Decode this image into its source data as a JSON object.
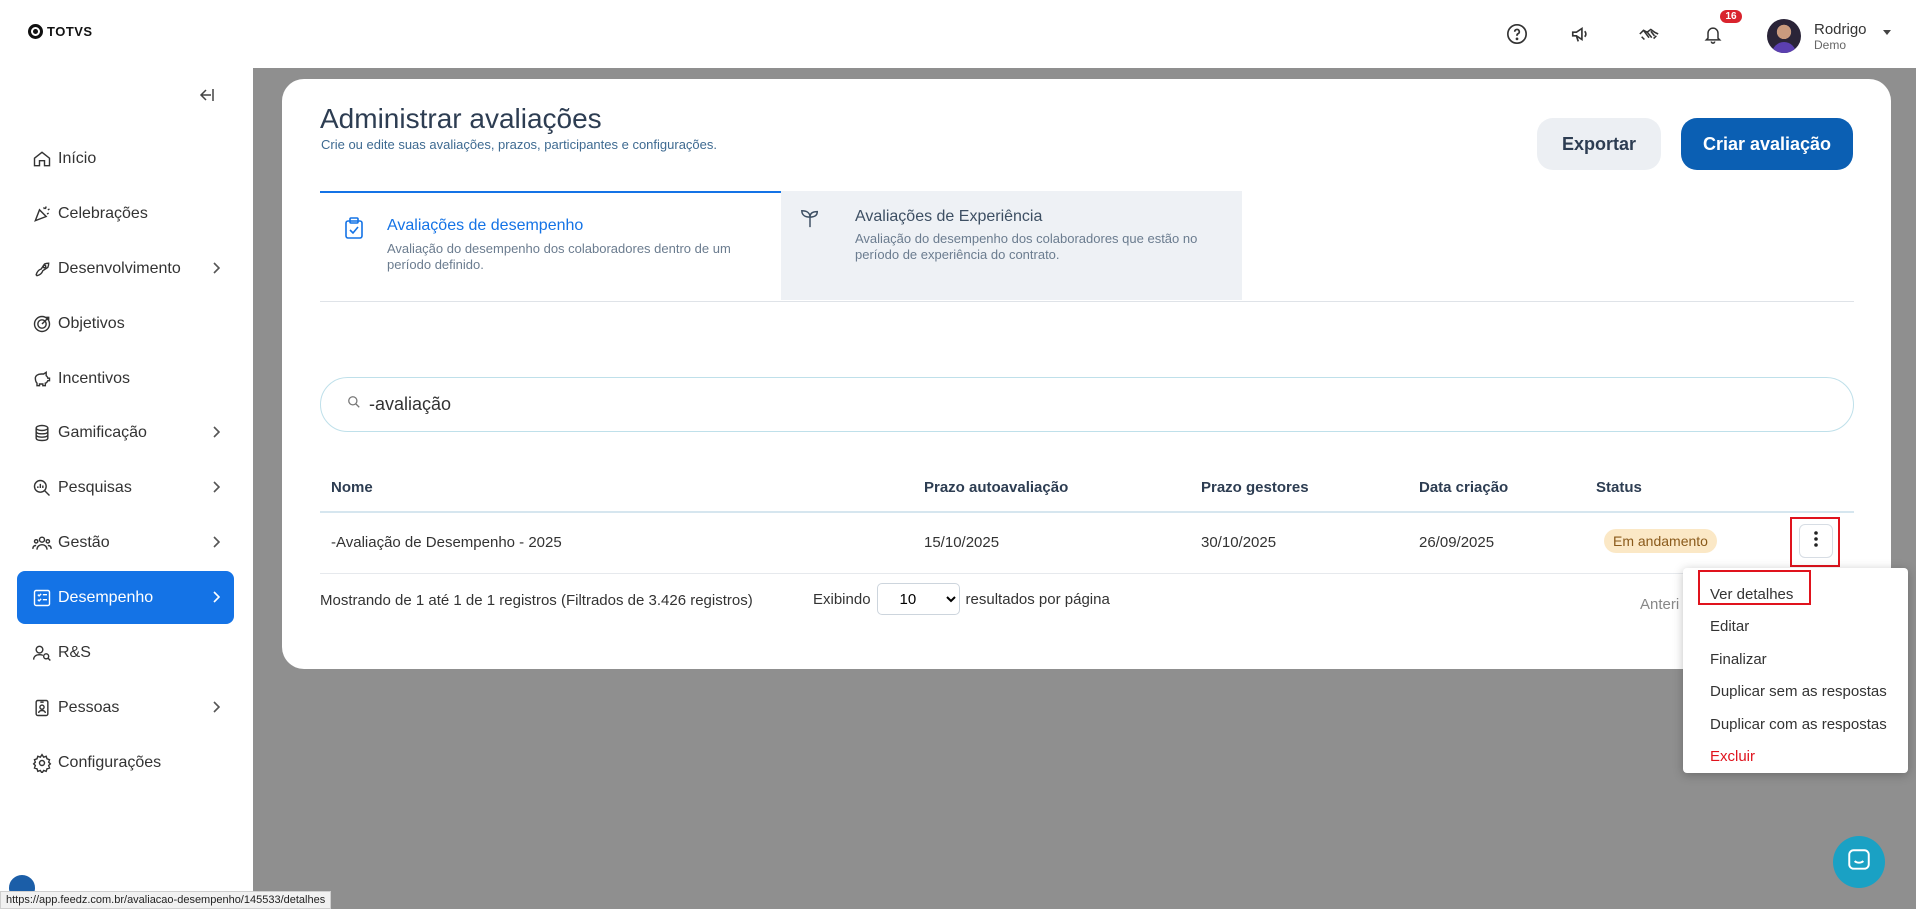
{
  "header": {
    "logo_text": "TOTVS",
    "notification_count": "16",
    "user_name": "Rodrigo",
    "user_subtitle": "Demo",
    "icons": [
      "help-icon",
      "megaphone-icon",
      "handshake-icon",
      "bell-icon"
    ]
  },
  "sidebar": {
    "collapse_icon": "collapse-left-icon",
    "items": [
      {
        "label": "Início",
        "icon": "home-icon",
        "chevron": false
      },
      {
        "label": "Celebrações",
        "icon": "party-icon",
        "chevron": false
      },
      {
        "label": "Desenvolvimento",
        "icon": "rocket-icon",
        "chevron": true
      },
      {
        "label": "Objetivos",
        "icon": "target-icon",
        "chevron": false
      },
      {
        "label": "Incentivos",
        "icon": "piggy-bank-icon",
        "chevron": false
      },
      {
        "label": "Gamificação",
        "icon": "coins-icon",
        "chevron": true
      },
      {
        "label": "Pesquisas",
        "icon": "chart-search-icon",
        "chevron": true
      },
      {
        "label": "Gestão",
        "icon": "team-icon",
        "chevron": true
      },
      {
        "label": "Desempenho",
        "icon": "checklist-icon",
        "chevron": true,
        "active": true
      },
      {
        "label": "R&S",
        "icon": "user-search-icon",
        "chevron": false
      },
      {
        "label": "Pessoas",
        "icon": "id-badge-icon",
        "chevron": true
      },
      {
        "label": "Configurações",
        "icon": "gear-icon",
        "chevron": false
      }
    ]
  },
  "page": {
    "title": "Administrar avaliações",
    "subtitle": "Crie ou edite suas avaliações, prazos, participantes e configurações.",
    "export_label": "Exportar",
    "create_label": "Criar avaliação"
  },
  "tabs": [
    {
      "title": "Avaliações de desempenho",
      "description": "Avaliação do desempenho dos colaboradores dentro de um período definido.",
      "active": true,
      "icon": "clipboard-check-icon"
    },
    {
      "title": "Avaliações de Experiência",
      "description": "Avaliação do desempenho dos colaboradores que estão no período de experiência do contrato.",
      "active": false,
      "icon": "sprout-icon"
    }
  ],
  "search": {
    "value": "-avaliação"
  },
  "table": {
    "columns": [
      "Nome",
      "Prazo autoavaliação",
      "Prazo gestores",
      "Data criação",
      "Status"
    ],
    "rows": [
      {
        "nome": "-Avaliação de Desempenho - 2025",
        "prazo_auto": "15/10/2025",
        "prazo_gestores": "30/10/2025",
        "data_criacao": "26/09/2025",
        "status": "Em andamento"
      }
    ]
  },
  "footer": {
    "info": "Mostrando de 1 até 1 de 1 registros (Filtrados de 3.426 registros)",
    "showing_label": "Exibindo",
    "per_page_value": "10",
    "per_page_suffix": "resultados por página",
    "prev_label": "Anteri"
  },
  "menu": {
    "items": [
      "Ver detalhes",
      "Editar",
      "Finalizar",
      "Duplicar sem as respostas",
      "Duplicar com as respostas",
      "Excluir"
    ]
  },
  "status_bar_url": "https://app.feedz.com.br/avaliacao-desempenho/145533/detalhes",
  "colors": {
    "primary": "#1473e6",
    "create_button": "#0b5fb3",
    "danger": "#e0131d",
    "status_bg": "#fbe8c6"
  }
}
